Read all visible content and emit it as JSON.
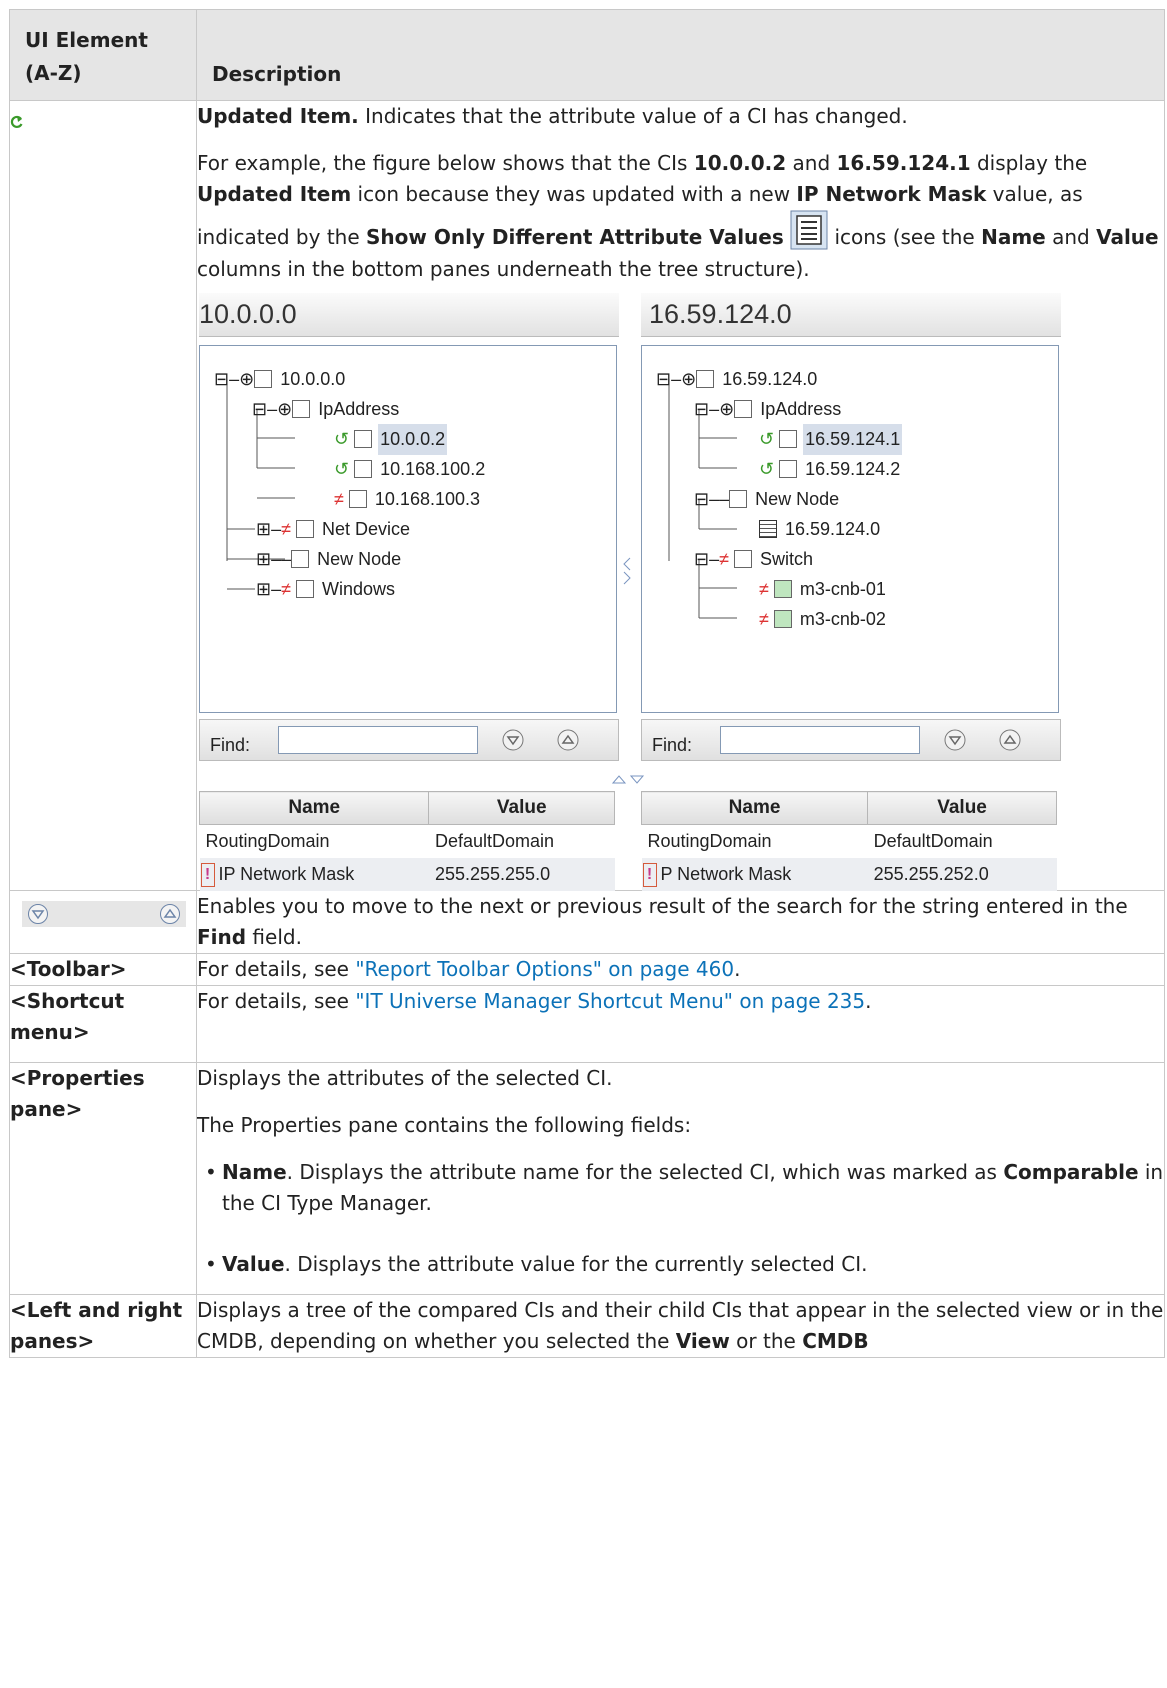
{
  "headers": {
    "ui_element": "UI Element (A-Z)",
    "description": "Description"
  },
  "row_updated": {
    "title": "Updated Item.",
    "title_rest": " Indicates that the attribute value of a CI has changed.",
    "p2_a": "For example, the figure below shows that the CIs ",
    "p2_ci1": "10.0.0.2",
    "p2_and": " and ",
    "p2_ci2": "16.59.124.1",
    "p2_b": " display the ",
    "p2_updated": "Updated Item",
    "p2_c": " icon because they was updated with a new ",
    "p2_mask": "IP Network Mask",
    "p2_d": " value, as indicated by the ",
    "p2_show": "Show Only Different Attribute Values",
    "p2_e": " icons (see the ",
    "p2_name": "Name",
    "p2_f": " and ",
    "p2_value": "Value",
    "p2_g": " columns in the bottom panes underneath the tree structure)."
  },
  "figure": {
    "left_title": "10.0.0.0",
    "right_title": "16.59.124.0",
    "left_tree": [
      "10.0.0.0",
      "IpAddress",
      "10.0.0.2",
      "10.168.100.2",
      "10.168.100.3",
      "Net Device",
      "New Node",
      "Windows"
    ],
    "right_tree": [
      "16.59.124.0",
      "IpAddress",
      "16.59.124.1",
      "16.59.124.2",
      "New Node",
      "16.59.124.0",
      "Switch",
      "m3-cnb-01",
      "m3-cnb-02"
    ],
    "find_label": "Find:",
    "col_name": "Name",
    "col_value": "Value",
    "left_rows": [
      [
        "RoutingDomain",
        "DefaultDomain"
      ],
      [
        "IP Network Mask",
        "255.255.255.0"
      ]
    ],
    "right_rows": [
      [
        "RoutingDomain",
        "DefaultDomain"
      ],
      [
        "P Network Mask",
        "255.255.252.0"
      ]
    ]
  },
  "row_nav": {
    "desc_a": "Enables you to move to the next or previous result of the search for the string entered in the ",
    "desc_find": "Find",
    "desc_b": " field."
  },
  "row_toolbar": {
    "element": "<Toolbar>",
    "desc": "For details, see ",
    "link": "\"Report Toolbar Options\" on page 460",
    "end": "."
  },
  "row_shortcut": {
    "element": "<Shortcut menu>",
    "desc": "For details, see ",
    "link": "\"IT Universe Manager Shortcut Menu\" on page 235",
    "end": "."
  },
  "row_properties": {
    "element": "<Properties pane>",
    "p1": "Displays the attributes of the selected CI.",
    "p2": "The Properties pane contains the following fields:",
    "f1_name": "Name",
    "f1_text": ". Displays the attribute name for the selected CI, which was marked as ",
    "f1_comparable": "Comparable",
    "f1_end": " in the CI Type Manager.",
    "f2_name": "Value",
    "f2_text": ". Displays the attribute value for the currently selected CI."
  },
  "row_panes": {
    "element": "<Left and right panes>",
    "desc_a": "Displays a tree of the compared CIs and their child CIs that appear in the selected view or in the CMDB, depending on whether you selected the ",
    "desc_view": "View",
    "desc_b": " or the ",
    "desc_cmdb": "CMDB"
  },
  "colors": {
    "link": "#0c72b8",
    "updated_icon": "#3a9a2a",
    "header_bg": "#e5e5e5"
  }
}
